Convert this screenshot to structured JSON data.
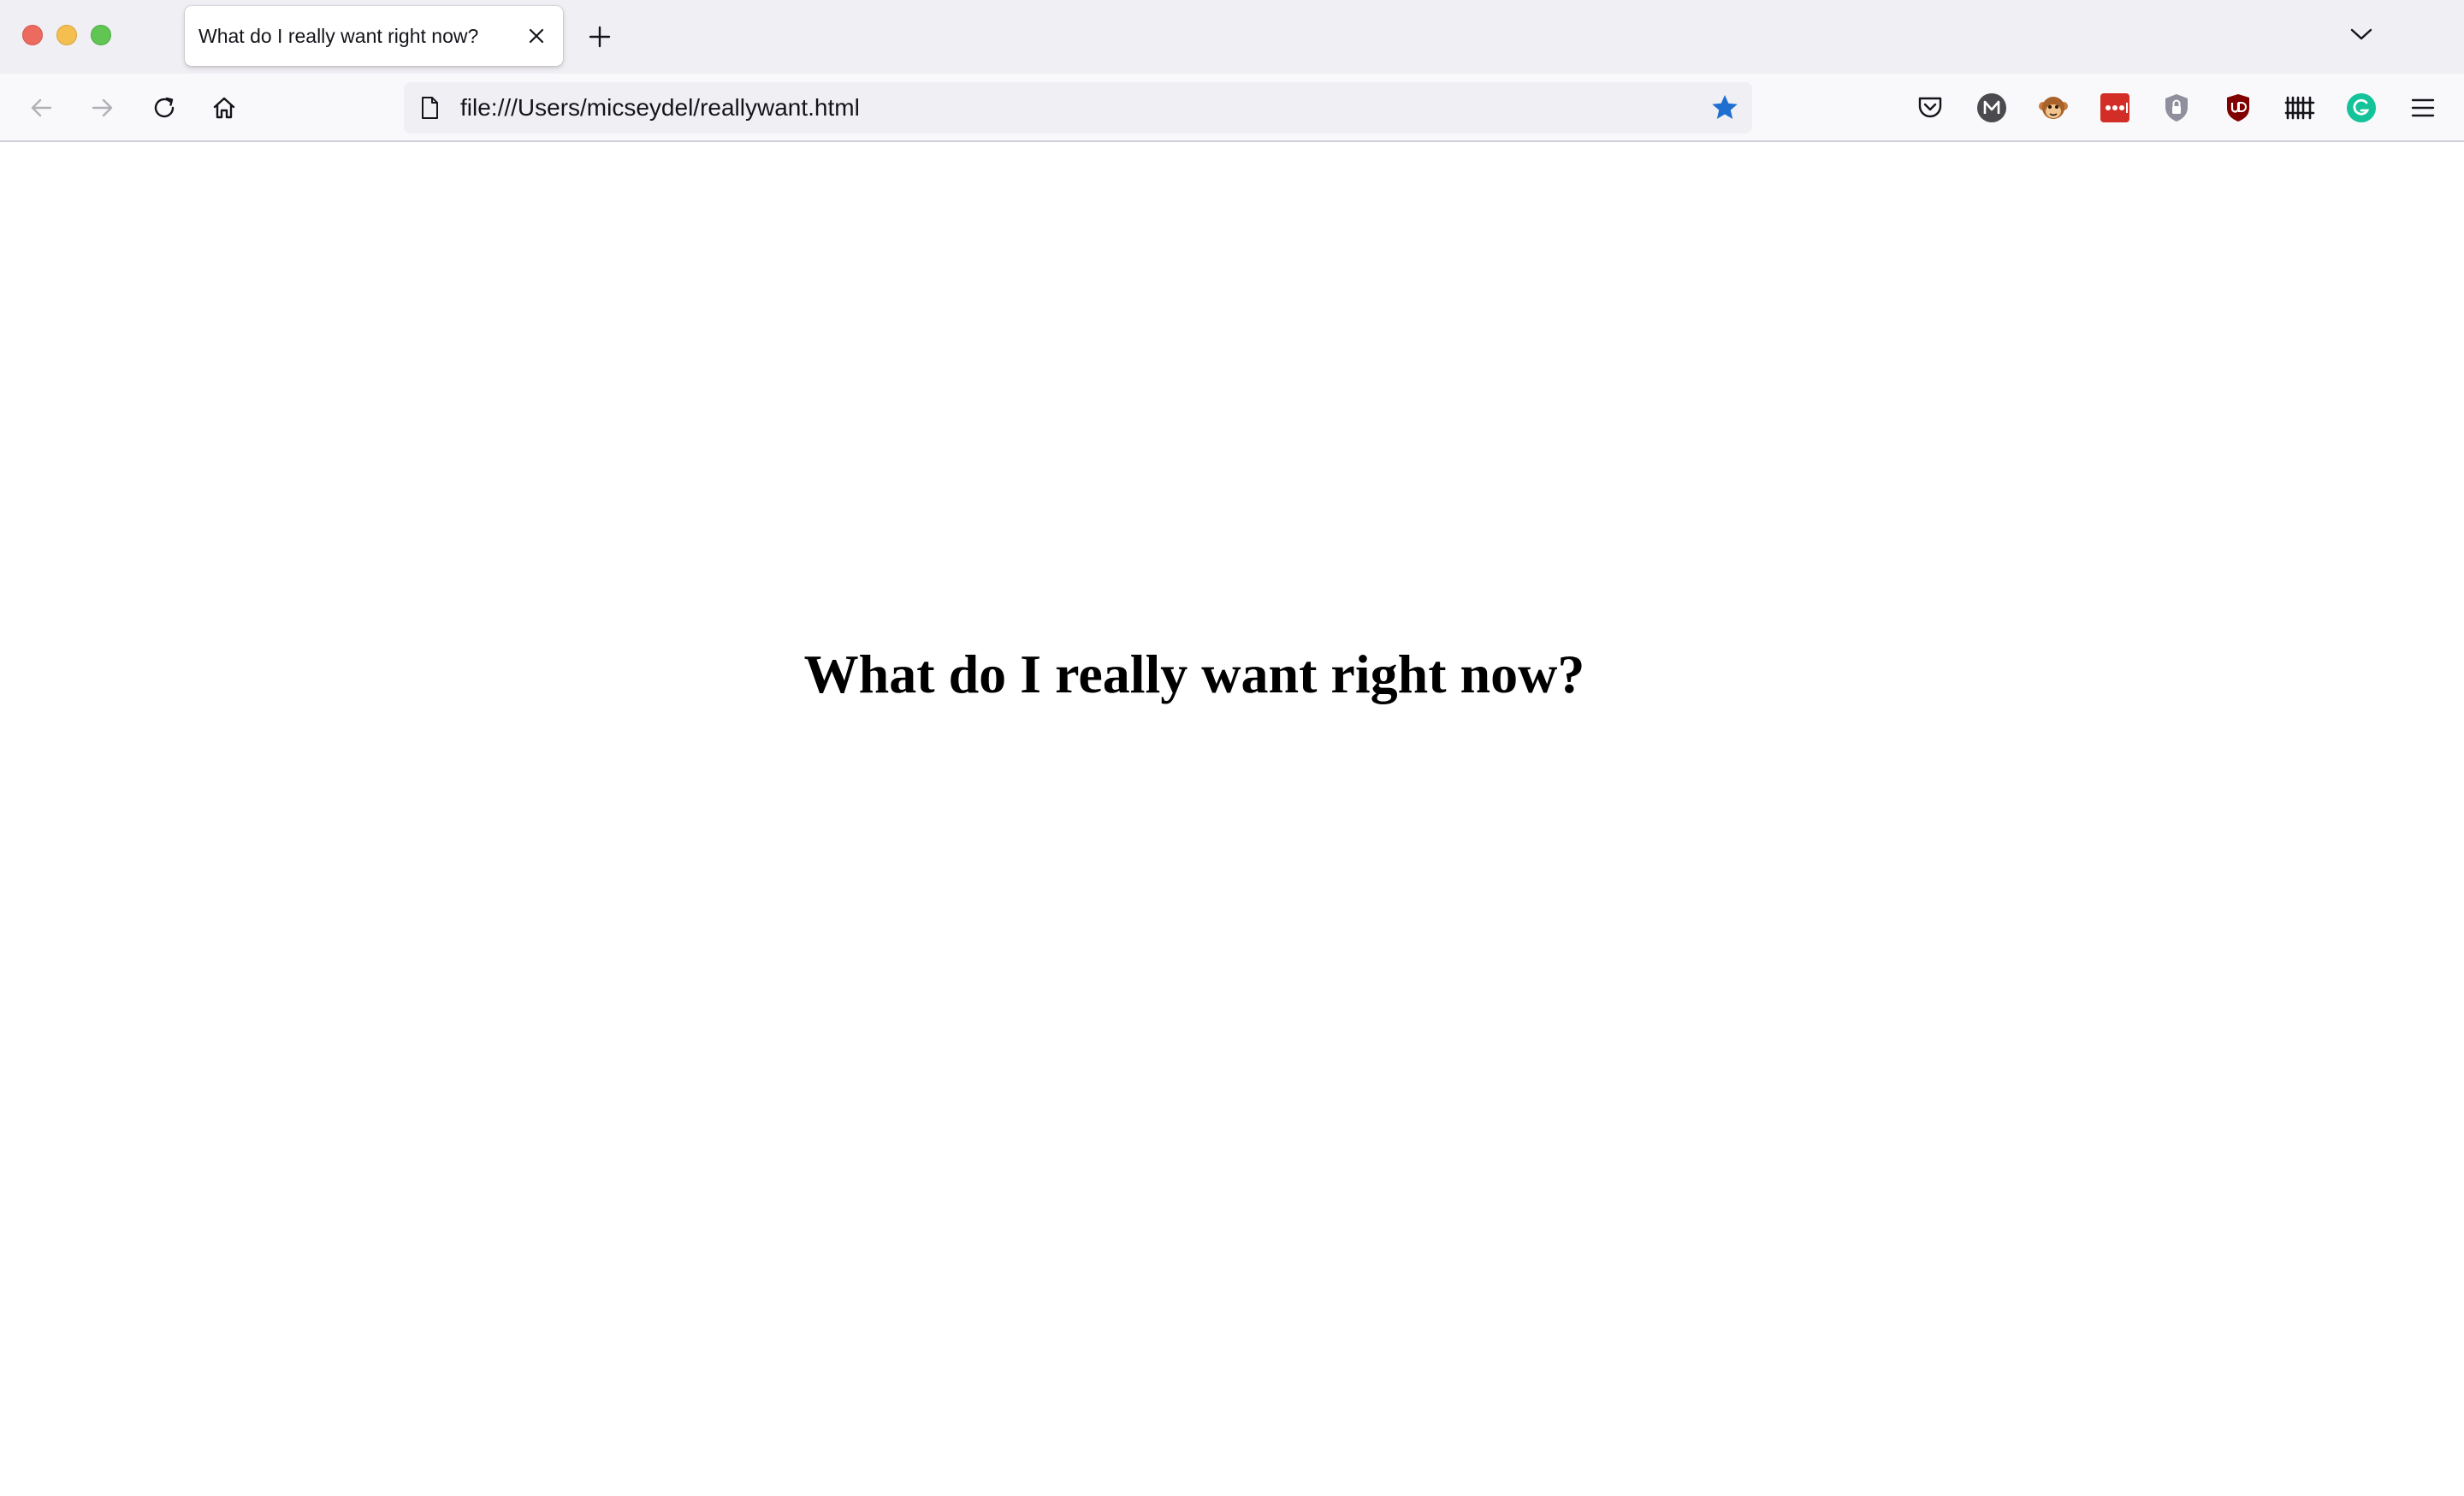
{
  "browser": {
    "tab": {
      "title": "What do I really want right now?"
    },
    "url": "file:///Users/micseydel/reallywant.html",
    "bookmark_star_color": "#1f6fd0"
  },
  "extensions": [
    "pocket-icon",
    "m-avatar-icon",
    "monkey-icon",
    "lastpass-icon",
    "shield-lock-icon",
    "ublock-origin-icon",
    "library-icon",
    "grammarly-icon",
    "menu-icon"
  ],
  "page": {
    "heading": "What do I really want right now?"
  }
}
